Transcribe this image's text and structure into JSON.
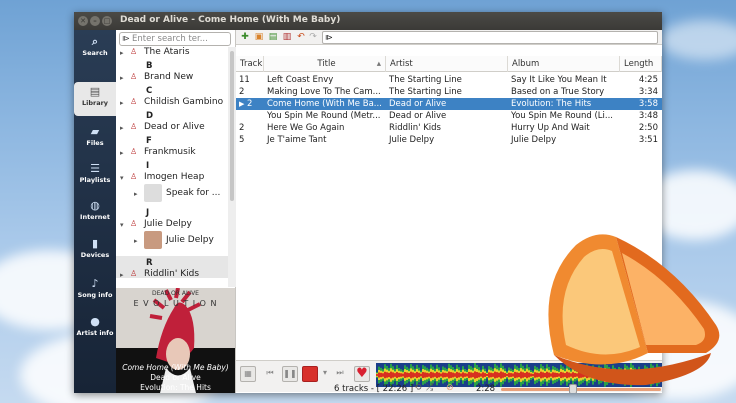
{
  "window": {
    "title": "Dead or Alive - Come Home (With Me Baby)"
  },
  "sidebar": {
    "items": [
      {
        "label": "Search",
        "icon": "search-icon"
      },
      {
        "label": "Library",
        "icon": "library-icon"
      },
      {
        "label": "Files",
        "icon": "folder-icon"
      },
      {
        "label": "Playlists",
        "icon": "playlist-icon"
      },
      {
        "label": "Internet",
        "icon": "globe-icon"
      },
      {
        "label": "Devices",
        "icon": "device-icon"
      },
      {
        "label": "Song info",
        "icon": "song-info-icon"
      },
      {
        "label": "Artist info",
        "icon": "artist-info-icon"
      }
    ]
  },
  "library": {
    "search_placeholder": "Enter search ter...",
    "entries": [
      {
        "kind": "artist",
        "name": "The Ataris"
      },
      {
        "kind": "letter",
        "name": "B"
      },
      {
        "kind": "artist",
        "name": "Brand New"
      },
      {
        "kind": "letter",
        "name": "C"
      },
      {
        "kind": "artist",
        "name": "Childish Gambino"
      },
      {
        "kind": "letter",
        "name": "D"
      },
      {
        "kind": "artist",
        "name": "Dead or Alive"
      },
      {
        "kind": "letter",
        "name": "F"
      },
      {
        "kind": "artist",
        "name": "Frankmusik"
      },
      {
        "kind": "letter",
        "name": "I"
      },
      {
        "kind": "artist",
        "name": "Imogen Heap",
        "expanded": true
      },
      {
        "kind": "album",
        "name": "Speak for ..."
      },
      {
        "kind": "letter",
        "name": "J"
      },
      {
        "kind": "artist",
        "name": "Julie Delpy",
        "expanded": true
      },
      {
        "kind": "album-selected",
        "name": "Julie Delpy"
      },
      {
        "kind": "letter",
        "name": "R"
      },
      {
        "kind": "artist",
        "name": "Riddlin' Kids"
      }
    ]
  },
  "now_playing": {
    "art_text": "DEAD OR ALIVE",
    "art_title": "E V O L U T I O N",
    "title": "Come Home (With Me Baby)",
    "artist": "Dead or Alive",
    "album": "Evolution: The Hits"
  },
  "toolbar": {
    "filter_value": ""
  },
  "playlist": {
    "columns": [
      "Track",
      "Title",
      "Artist",
      "Album",
      "Length"
    ],
    "rows": [
      {
        "track": "11",
        "title": "Left Coast Envy",
        "artist": "The Starting Line",
        "album": "Say It Like You Mean It",
        "length": "4:25"
      },
      {
        "track": "2",
        "title": "Making Love To The Cam...",
        "artist": "The Starting Line",
        "album": "Based on a True Story",
        "length": "3:34"
      },
      {
        "track": "2",
        "title": "Come Home (With Me Ba...",
        "artist": "Dead or Alive",
        "album": "Evolution: The Hits",
        "length": "3:58",
        "playing": true
      },
      {
        "track": "",
        "title": "You Spin Me Round (Metr...",
        "artist": "Dead or Alive",
        "album": "You Spin Me Round (Li...",
        "length": "3:48"
      },
      {
        "track": "2",
        "title": "Here We Go Again",
        "artist": "Riddlin' Kids",
        "album": "Hurry Up And Wait",
        "length": "2:50"
      },
      {
        "track": "5",
        "title": "Je T'aime Tant",
        "artist": "Julie Delpy",
        "album": "Julie Delpy",
        "length": "3:51"
      }
    ]
  },
  "status": {
    "tracks": "6 tracks - [ 22:26 ]",
    "position": "2:28",
    "progress": 0.45
  },
  "colors": {
    "accent": "#3d82c4",
    "sidebar": "#1e2d42"
  }
}
